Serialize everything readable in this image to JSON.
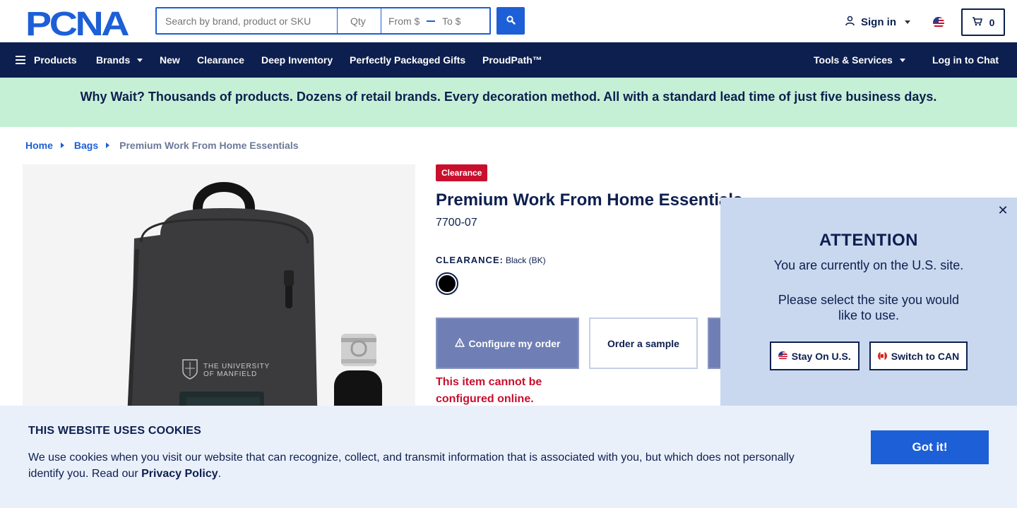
{
  "header": {
    "logo_text": "PCNA",
    "search_placeholder": "Search by brand, product or SKU",
    "qty_placeholder": "Qty",
    "price_from_placeholder": "From $",
    "price_to_placeholder": "To $",
    "signin_label": "Sign in",
    "cart_count": "0",
    "icons": {
      "search": "search-icon",
      "user": "user-icon",
      "cart": "cart-icon",
      "flag": "us-flag-icon"
    }
  },
  "nav": {
    "products": "Products",
    "brands": "Brands",
    "new": "New",
    "clearance": "Clearance",
    "deep_inventory": "Deep Inventory",
    "gifts": "Perfectly Packaged Gifts",
    "proudpath": "ProudPath™",
    "tools": "Tools & Services",
    "chat": "Log in to Chat"
  },
  "promo": {
    "text": "Why Wait? Thousands of products. Dozens of retail brands. Every decoration method. All with a standard lead time of just five business days."
  },
  "breadcrumb": {
    "home": "Home",
    "category": "Bags",
    "current": "Premium Work From Home Essentials"
  },
  "product": {
    "badge": "Clearance",
    "title": "Premium Work From Home Essentials",
    "sku": "7700-07",
    "color_label": "CLEARANCE:",
    "color_value": "Black (BK)",
    "swatch_color": "#000000",
    "configure_label": "Configure my order",
    "sample_label": "Order a sample",
    "warning": "This item cannot be configured online.",
    "imprint_text": "THE UNIVERSITY OF MANFIELD"
  },
  "attention": {
    "title": "ATTENTION",
    "line1": "You are currently on the U.S. site.",
    "line2": "Please select the site you would like to use.",
    "stay_label": "Stay On U.S.",
    "switch_label": "Switch to CAN",
    "close_glyph": "✕"
  },
  "cookies": {
    "title": "THIS WEBSITE USES COOKIES",
    "text": "We use cookies when you visit our website that can recognize, collect, and transmit information that is associated with you, but which does not personally identify you. Read our ",
    "link": "Privacy Policy",
    "suffix": ".",
    "button": "Got it!"
  },
  "colors": {
    "brand_blue": "#1d5fd6",
    "navy": "#0d1f4f",
    "promo_green": "#c6f0d6",
    "clearance_red": "#c8102e",
    "modal_bg": "#c9d8ee",
    "cookie_bg": "#eaf0fa"
  }
}
